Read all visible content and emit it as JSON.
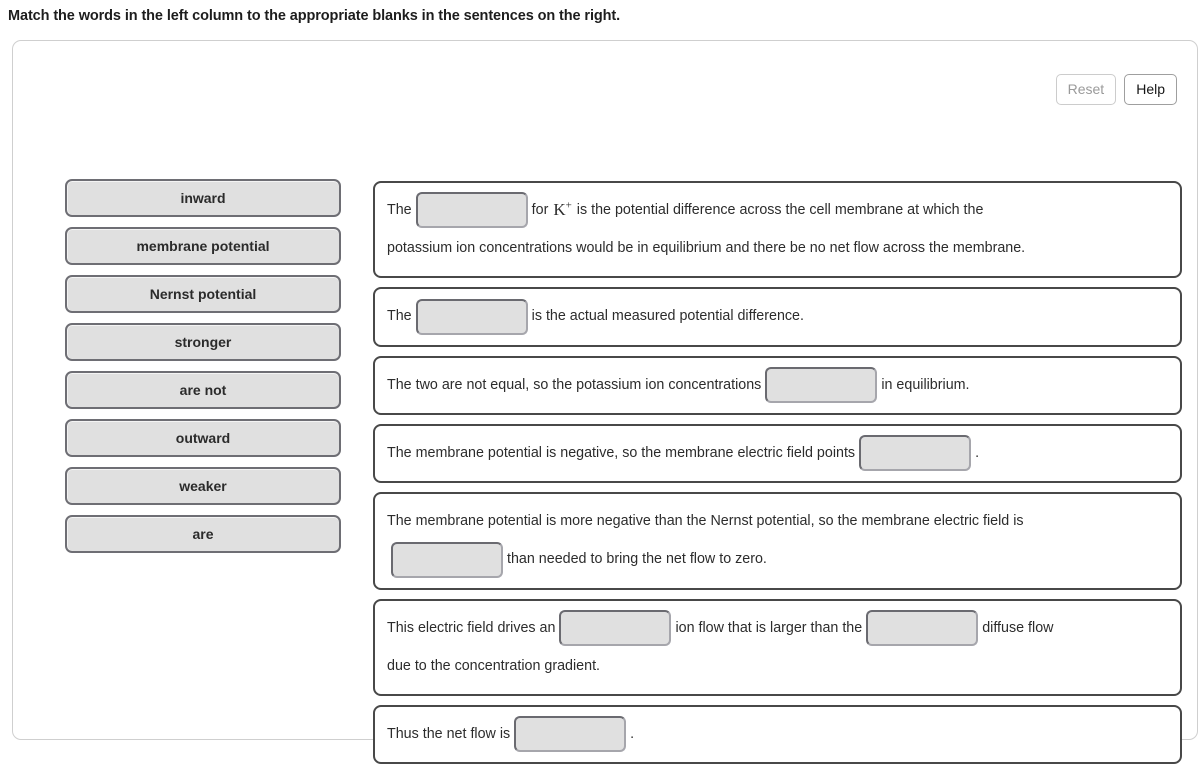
{
  "page": {
    "title": "Match the words in the left column to the appropriate blanks in the sentences on the right."
  },
  "toolbar": {
    "reset_label": "Reset",
    "help_label": "Help"
  },
  "word_bank": {
    "tiles": [
      {
        "label": "inward"
      },
      {
        "label": "membrane potential"
      },
      {
        "label": "Nernst potential"
      },
      {
        "label": "stronger"
      },
      {
        "label": "are not"
      },
      {
        "label": "outward"
      },
      {
        "label": "weaker"
      },
      {
        "label": "are"
      }
    ]
  },
  "sentences": [
    {
      "id": "sentence-1",
      "lines": [
        [
          {
            "type": "text",
            "value": "The"
          },
          {
            "type": "blank",
            "value": ""
          },
          {
            "type": "text",
            "value": "for"
          },
          {
            "type": "ion",
            "symbol": "K",
            "charge": "+"
          },
          {
            "type": "text",
            "value": "is the potential difference across the cell membrane at which the"
          }
        ],
        [
          {
            "type": "text",
            "value": "potassium ion concentrations would be in equilibrium and there be no net flow across the membrane."
          }
        ]
      ]
    },
    {
      "id": "sentence-2",
      "lines": [
        [
          {
            "type": "text",
            "value": "The"
          },
          {
            "type": "blank",
            "value": ""
          },
          {
            "type": "text",
            "value": "is the actual measured potential difference."
          }
        ]
      ]
    },
    {
      "id": "sentence-3",
      "lines": [
        [
          {
            "type": "text",
            "value": "The two are not equal, so the potassium ion concentrations"
          },
          {
            "type": "blank",
            "value": ""
          },
          {
            "type": "text",
            "value": "in equilibrium."
          }
        ]
      ]
    },
    {
      "id": "sentence-4",
      "lines": [
        [
          {
            "type": "text",
            "value": "The membrane potential is negative, so the membrane electric field points"
          },
          {
            "type": "blank",
            "value": ""
          },
          {
            "type": "text",
            "value": "."
          }
        ]
      ]
    },
    {
      "id": "sentence-5",
      "lines": [
        [
          {
            "type": "text",
            "value": "The membrane potential is more negative than the Nernst potential, so the membrane electric field is"
          }
        ],
        [
          {
            "type": "blank",
            "value": ""
          },
          {
            "type": "text",
            "value": "than needed to bring the net flow to zero."
          }
        ]
      ]
    },
    {
      "id": "sentence-6",
      "lines": [
        [
          {
            "type": "text",
            "value": "This electric field drives an"
          },
          {
            "type": "blank",
            "value": ""
          },
          {
            "type": "text",
            "value": "ion flow that is larger than the"
          },
          {
            "type": "blank",
            "value": ""
          },
          {
            "type": "text",
            "value": "diffuse flow"
          }
        ],
        [
          {
            "type": "text",
            "value": "due to the concentration gradient."
          }
        ]
      ]
    },
    {
      "id": "sentence-7",
      "lines": [
        [
          {
            "type": "text",
            "value": "Thus the net flow is"
          },
          {
            "type": "blank",
            "value": ""
          },
          {
            "type": "text",
            "value": "."
          }
        ]
      ]
    }
  ],
  "colors": {
    "tile_fill": "#e0e0e0",
    "tile_border": "#6e6e74",
    "sentence_border": "#484848",
    "text": "#2c2c2c",
    "panel_border": "#cfcfcf"
  }
}
